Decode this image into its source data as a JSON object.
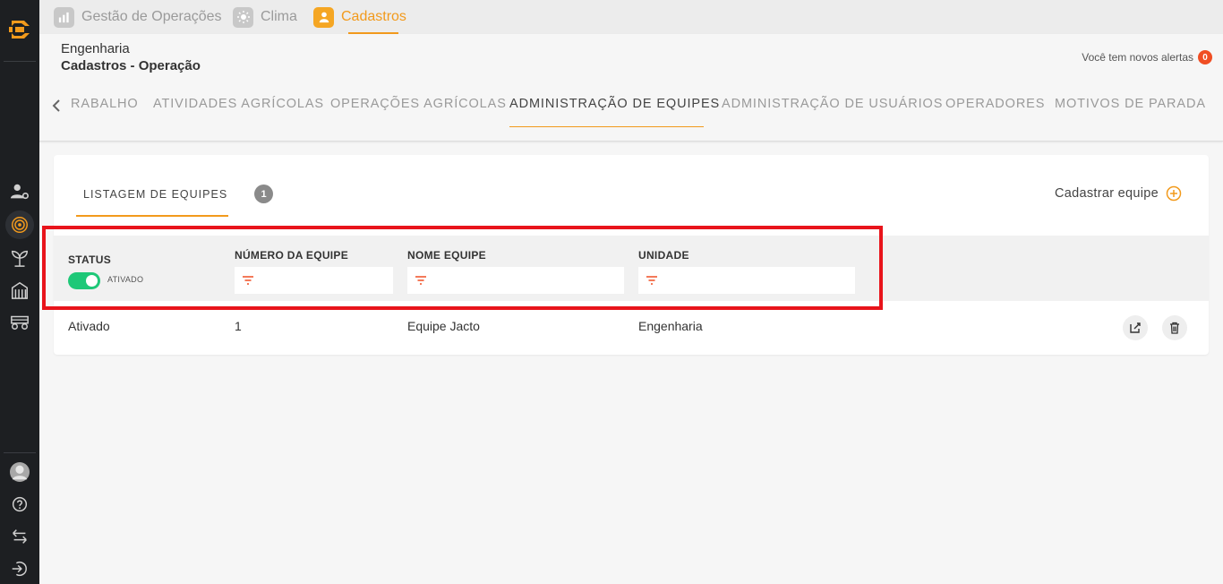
{
  "colors": {
    "accent": "#f29a1c",
    "sidebar": "#1d1f22",
    "toggle_on": "#1ec878",
    "alert_badge": "#f04e23",
    "highlight": "#e8141b"
  },
  "sidebar": {
    "icons": [
      "logo-icon",
      "user-settings-icon",
      "target-icon",
      "plant-icon",
      "silo-icon",
      "tractor-icon",
      "avatar",
      "help-icon",
      "switch-icon",
      "logout-icon"
    ]
  },
  "topnav": {
    "items": [
      {
        "label": "Gestão de Operações",
        "icon": "chart-icon"
      },
      {
        "label": "Clima",
        "icon": "sun-icon"
      },
      {
        "label": "Cadastros",
        "icon": "user-icon"
      }
    ]
  },
  "header": {
    "crumb_org": "Engenharia",
    "crumb_page": "Cadastros - Operação",
    "alerts_text": "Você tem novos alertas",
    "alerts_count": "0"
  },
  "tabs": [
    "RABALHO",
    "ATIVIDADES AGRÍCOLAS",
    "OPERAÇÕES AGRÍCOLAS",
    "ADMINISTRAÇÃO DE EQUIPES",
    "ADMINISTRAÇÃO DE USUÁRIOS",
    "OPERADORES",
    "MOTIVOS DE PARADA"
  ],
  "card": {
    "tab_label": "LISTAGEM DE EQUIPES",
    "count": "1",
    "add_label": "Cadastrar equipe",
    "filters": {
      "status_label": "STATUS",
      "status_toggle_label": "ATIVADO",
      "numero_label": "NÚMERO DA EQUIPE",
      "nome_label": "NOME EQUIPE",
      "unidade_label": "UNIDADE"
    },
    "rows": [
      {
        "status": "Ativado",
        "numero": "1",
        "nome": "Equipe Jacto",
        "unidade": "Engenharia"
      }
    ]
  }
}
